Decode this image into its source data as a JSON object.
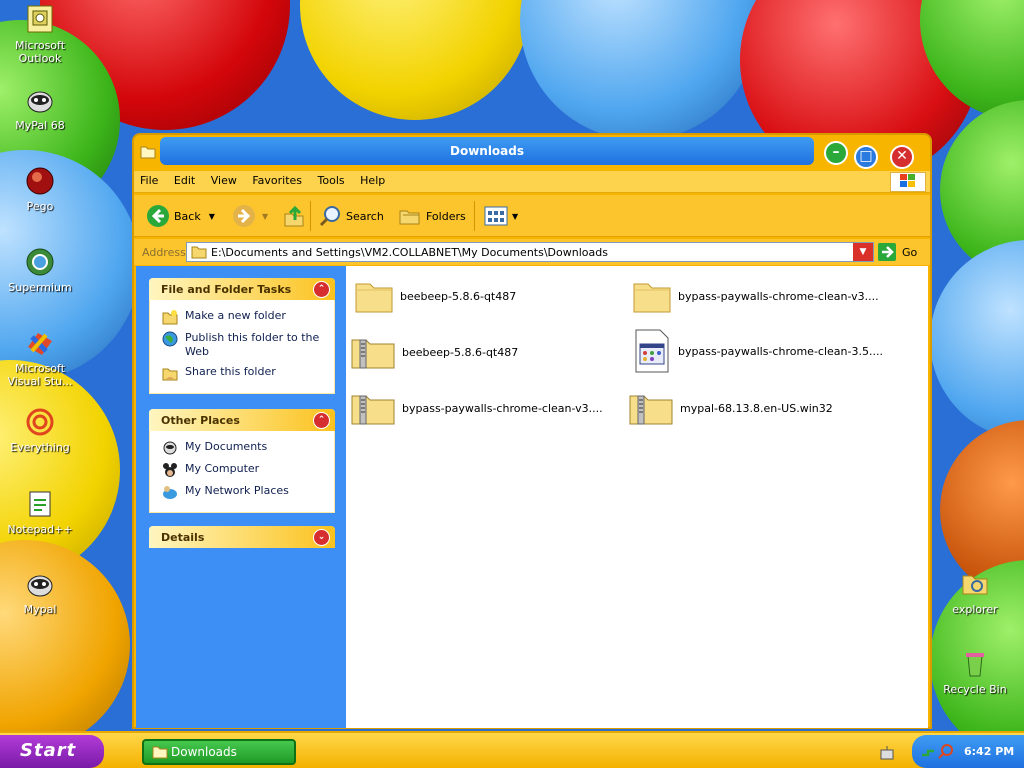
{
  "desktop": {
    "icons": [
      {
        "label": "Microsoft Outlook",
        "icon": "outlook-icon"
      },
      {
        "label": "MyPal 68",
        "icon": "mypal-icon"
      },
      {
        "label": "Pego",
        "icon": "pego-icon"
      },
      {
        "label": "Supermium",
        "icon": "supermium-icon"
      },
      {
        "label": "Microsoft Visual Stu...",
        "icon": "visual-studio-icon"
      },
      {
        "label": "Everything",
        "icon": "everything-icon"
      },
      {
        "label": "Notepad++",
        "icon": "notepadpp-icon"
      },
      {
        "label": "Mypal",
        "icon": "mypal-icon"
      },
      {
        "label": "explorer",
        "icon": "explorer-icon"
      },
      {
        "label": "Recycle Bin",
        "icon": "recycle-bin-icon"
      }
    ]
  },
  "window": {
    "title": "Downloads",
    "menu": [
      "File",
      "Edit",
      "View",
      "Favorites",
      "Tools",
      "Help"
    ],
    "toolbar": {
      "back": "Back",
      "search": "Search",
      "folders": "Folders"
    },
    "address": {
      "label": "Address",
      "value": "E:\\Documents and Settings\\VM2.COLLABNET\\My Documents\\Downloads",
      "go": "Go"
    },
    "task_panes": {
      "file_folder_tasks": {
        "title": "File and Folder Tasks",
        "items": [
          "Make a new folder",
          "Publish this folder to the Web",
          "Share this folder"
        ]
      },
      "other_places": {
        "title": "Other Places",
        "items": [
          "My Documents",
          "My Computer",
          "My Network Places"
        ]
      },
      "details": {
        "title": "Details"
      }
    },
    "files": [
      {
        "name": "beebeep-5.8.6-qt487",
        "type": "folder"
      },
      {
        "name": "bypass-paywalls-chrome-clean-v3....",
        "type": "folder"
      },
      {
        "name": "beebeep-5.8.6-qt487",
        "type": "zip"
      },
      {
        "name": "bypass-paywalls-chrome-clean-3.5....",
        "type": "exe"
      },
      {
        "name": "bypass-paywalls-chrome-clean-v3....",
        "type": "zip"
      },
      {
        "name": "mypal-68.13.8.en-US.win32",
        "type": "zip"
      }
    ]
  },
  "taskbar": {
    "start": "Start",
    "task": "Downloads",
    "time": "6:42 PM"
  },
  "colors": {
    "window_frame": "#f7b500",
    "title_pill": "#1f71e0",
    "left_pane": "#3d8ef5",
    "taskbar": "#f4b100",
    "start_button": "#7a1aa8",
    "task_button": "#1f9a26"
  }
}
